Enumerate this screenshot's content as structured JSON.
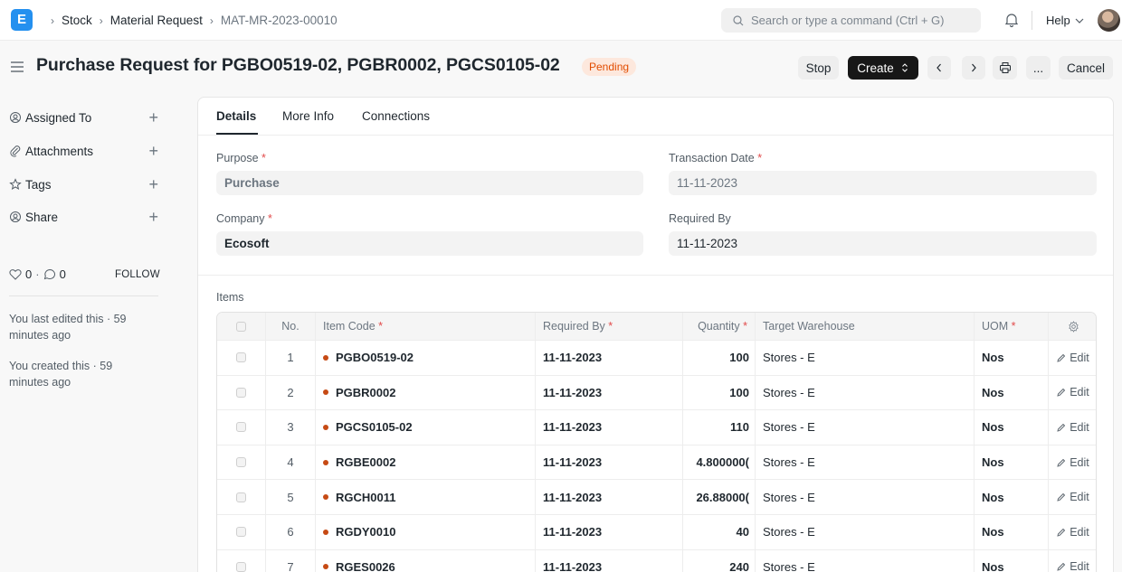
{
  "navbar": {
    "logo": "E",
    "breadcrumbs": [
      "Stock",
      "Material Request",
      "MAT-MR-2023-00010"
    ],
    "search_placeholder": "Search or type a command (Ctrl + G)",
    "help_label": "Help"
  },
  "page": {
    "title": "Purchase Request for PGBO0519-02, PGBR0002, PGCS0105-02",
    "status": "Pending",
    "buttons": {
      "stop": "Stop",
      "create": "Create",
      "more": "...",
      "cancel": "Cancel"
    }
  },
  "sidebar": {
    "items": [
      {
        "label": "Assigned To",
        "icon": "assign-icon"
      },
      {
        "label": "Attachments",
        "icon": "paperclip-icon"
      },
      {
        "label": "Tags",
        "icon": "tag-icon"
      },
      {
        "label": "Share",
        "icon": "share-icon"
      }
    ],
    "likes": "0",
    "comments": "0",
    "follow": "FOLLOW",
    "activity": [
      "You last edited this · 59 minutes ago",
      "You created this · 59 minutes ago"
    ]
  },
  "tabs": [
    "Details",
    "More Info",
    "Connections"
  ],
  "form": {
    "purpose_label": "Purpose",
    "purpose_value": "Purchase",
    "transaction_date_label": "Transaction Date",
    "transaction_date_value": "11-11-2023",
    "company_label": "Company",
    "company_value": "Ecosoft",
    "required_by_label": "Required By",
    "required_by_value": "11-11-2023",
    "items_label": "Items"
  },
  "grid": {
    "headers": {
      "no": "No.",
      "item_code": "Item Code",
      "required_by": "Required By",
      "quantity": "Quantity",
      "target_warehouse": "Target Warehouse",
      "uom": "UOM"
    },
    "edit_label": "Edit",
    "rows": [
      {
        "no": "1",
        "item_code": "PGBO0519-02",
        "required_by": "11-11-2023",
        "quantity": "100",
        "warehouse": "Stores - E",
        "uom": "Nos"
      },
      {
        "no": "2",
        "item_code": "PGBR0002",
        "required_by": "11-11-2023",
        "quantity": "100",
        "warehouse": "Stores - E",
        "uom": "Nos"
      },
      {
        "no": "3",
        "item_code": "PGCS0105-02",
        "required_by": "11-11-2023",
        "quantity": "110",
        "warehouse": "Stores - E",
        "uom": "Nos"
      },
      {
        "no": "4",
        "item_code": "RGBE0002",
        "required_by": "11-11-2023",
        "quantity": "4.800000(",
        "warehouse": "Stores - E",
        "uom": "Nos"
      },
      {
        "no": "5",
        "item_code": "RGCH0011",
        "required_by": "11-11-2023",
        "quantity": "26.88000(",
        "warehouse": "Stores - E",
        "uom": "Nos"
      },
      {
        "no": "6",
        "item_code": "RGDY0010",
        "required_by": "11-11-2023",
        "quantity": "40",
        "warehouse": "Stores - E",
        "uom": "Nos"
      },
      {
        "no": "7",
        "item_code": "RGES0026",
        "required_by": "11-11-2023",
        "quantity": "240",
        "warehouse": "Stores - E",
        "uom": "Nos"
      }
    ]
  }
}
